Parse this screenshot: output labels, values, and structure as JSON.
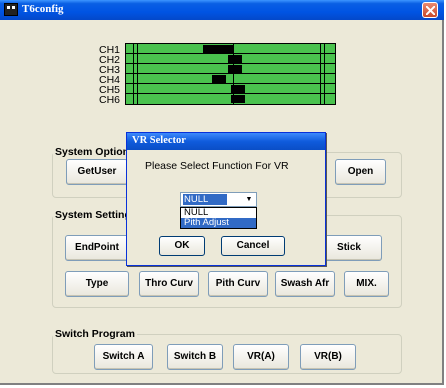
{
  "window": {
    "title": "T6config"
  },
  "channels": {
    "labels": [
      "CH1",
      "CH2",
      "CH3",
      "CH4",
      "CH5",
      "CH6"
    ],
    "indicator_fraction": [
      0.37,
      0.49,
      0.49,
      0.41,
      0.5,
      0.5
    ]
  },
  "system_option": {
    "legend": "System Option",
    "buttons": [
      "GetUser",
      "Open"
    ]
  },
  "system_setting": {
    "legend": "System Setting",
    "row1": [
      "EndPoint",
      "Stick"
    ],
    "row2": [
      "Type",
      "Thro Curv",
      "Pith Curv",
      "Swash Afr",
      "MIX."
    ]
  },
  "switch_program": {
    "legend": "Switch Program",
    "buttons": [
      "Switch A",
      "Switch B",
      "VR(A)",
      "VR(B)"
    ]
  },
  "dialog": {
    "title": "VR Selector",
    "prompt": "Please Select Function For  VR",
    "select_value": "NULL",
    "options": [
      "NULL",
      "Pith Adjust"
    ],
    "ok_label": "OK",
    "cancel_label": "Cancel"
  },
  "colors": {
    "channel_bar": "#4ac24e",
    "title_bar": "#0054e3",
    "window_bg": "#ece9d8",
    "selection": "#316ac5"
  },
  "icons": {
    "close": "close-icon",
    "app": "app-icon",
    "dropdown": "chevron-down-icon"
  }
}
